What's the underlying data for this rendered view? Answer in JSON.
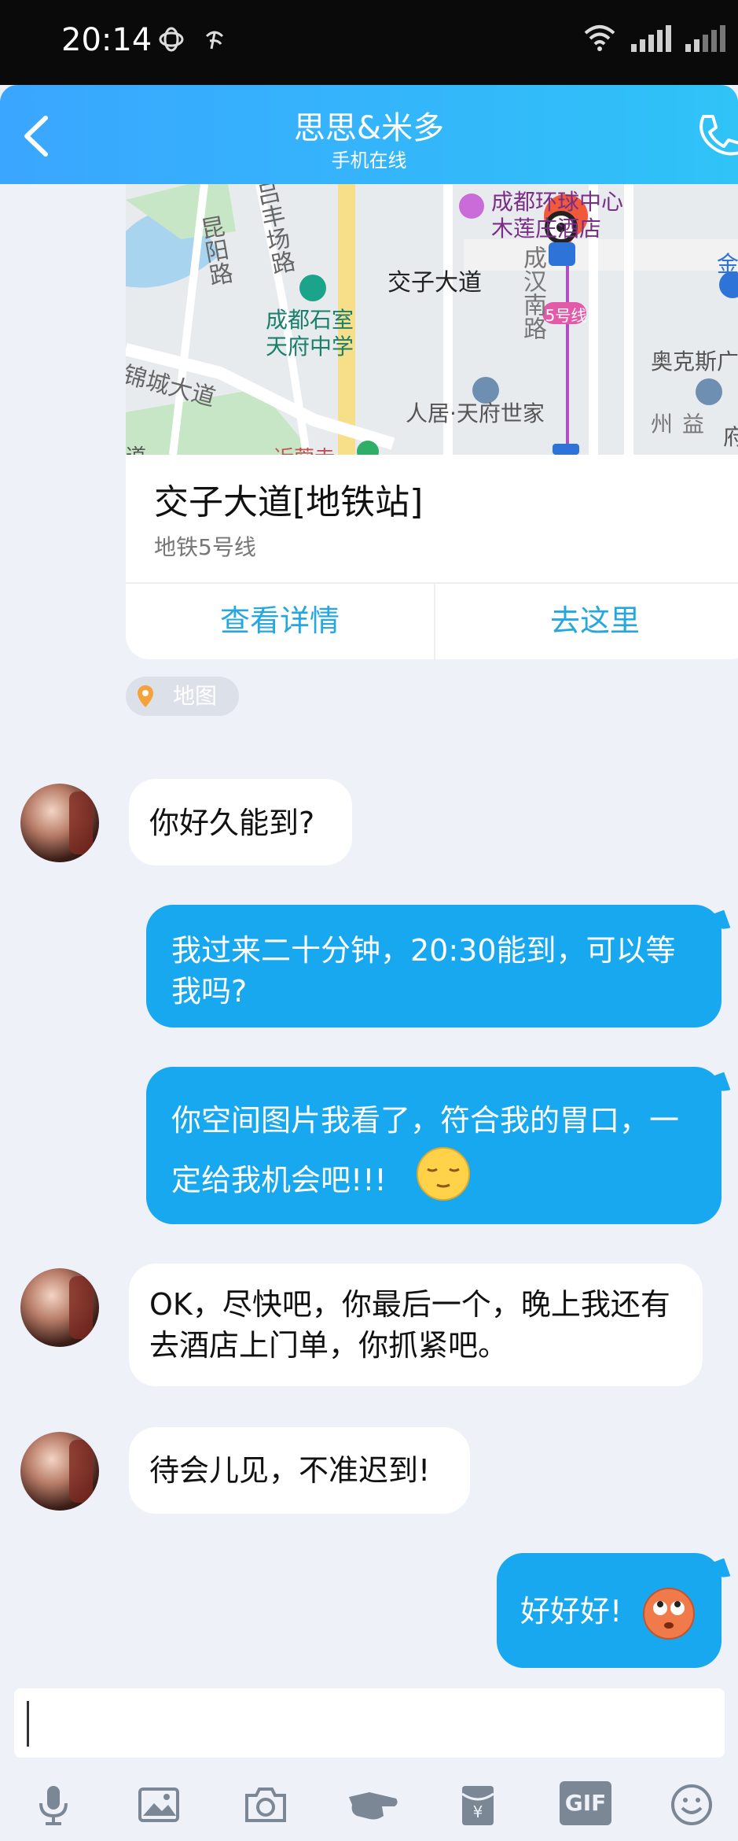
{
  "status_bar": {
    "time": "20:14",
    "carrier_icons": [
      "china-mobile-icon",
      "china-telecom-icon"
    ],
    "system_icons": [
      "wifi-icon",
      "signal-icon",
      "signal-icon"
    ]
  },
  "header": {
    "title": "思思&米多",
    "subtitle": "手机在线",
    "icons": [
      "back-icon",
      "phone-icon"
    ]
  },
  "map_card": {
    "map_labels": {
      "hotel": "成都环球中心\n木莲庄酒店",
      "station": "交子大道",
      "line_badge": "5号线",
      "school": "成都石室\n天府中学",
      "road1": "锦城大道",
      "road2": "昆阳路",
      "road3": "吕丰场路",
      "road4": "成汉南路",
      "community": "人居·天府世家",
      "mall": "奥克斯广",
      "road5": "益州",
      "edge1": "金",
      "edge2": "府",
      "edge3": "近蓉寺",
      "edge4": "道"
    },
    "title": "交子大道[地铁站]",
    "subtitle": "地铁5号线",
    "btn_details": "查看详情",
    "btn_go": "去这里"
  },
  "map_tag": "地图",
  "messages": [
    {
      "side": "in",
      "text": "你好久能到?"
    },
    {
      "side": "out",
      "text": "我过来二十分钟，20:30能到，可以等我吗?"
    },
    {
      "side": "out",
      "text": "你空间图片我看了，符合我的胃口，一定给我机会吧!!!",
      "emoji": "relieved-emoji"
    },
    {
      "side": "in",
      "text": "OK，尽快吧，你最后一个，晚上我还有去酒店上门单，你抓紧吧。"
    },
    {
      "side": "in",
      "text": "待会儿见，不准迟到!"
    },
    {
      "side": "out",
      "text": "好好好!",
      "emoji": "eye-roll-emoji"
    }
  ],
  "input": {
    "value": ""
  },
  "toolbar": {
    "icons": [
      "microphone-icon",
      "image-icon",
      "camera-icon",
      "poke-icon",
      "red-packet-icon",
      "gif-icon",
      "emoji-icon"
    ],
    "gif_label": "GIF"
  },
  "colors": {
    "header_start": "#3aa6ff",
    "header_end": "#2fc3f7",
    "out_bubble": "#17a8f0",
    "link": "#25a7e0"
  }
}
